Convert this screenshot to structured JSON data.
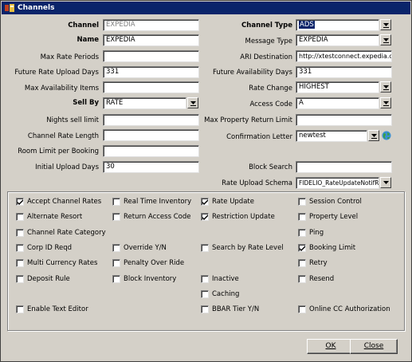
{
  "window": {
    "title": "Channels",
    "icon": "app-icon"
  },
  "form": {
    "channel": {
      "label": "Channel",
      "value": "EXPEDIA"
    },
    "name": {
      "label": "Name",
      "value": "EXPEDIA"
    },
    "max_rate_periods": {
      "label": "Max Rate Periods",
      "value": ""
    },
    "future_rate_upload_days": {
      "label": "Future Rate Upload Days",
      "value": "331"
    },
    "max_availability_items": {
      "label": "Max Availability Items",
      "value": ""
    },
    "sell_by": {
      "label": "Sell By",
      "value": "RATE"
    },
    "nights_sell_limit": {
      "label": "Nights sell limit",
      "value": ""
    },
    "channel_rate_length": {
      "label": "Channel Rate Length",
      "value": ""
    },
    "room_limit_per_booking": {
      "label": "Room Limit per Booking",
      "value": ""
    },
    "initial_upload_days": {
      "label": "Initial Upload Days",
      "value": "30"
    },
    "channel_type": {
      "label": "Channel Type",
      "value": "ADS"
    },
    "message_type": {
      "label": "Message Type",
      "value": "EXPEDIA"
    },
    "ari_destination": {
      "label": "ARI Destination",
      "value": "http://xtestconnect.expedia.co"
    },
    "future_availability_days": {
      "label": "Future Availability Days",
      "value": "331"
    },
    "rate_change": {
      "label": "Rate Change",
      "value": "HIGHEST"
    },
    "access_code": {
      "label": "Access Code",
      "value": "A"
    },
    "max_property_return_limit": {
      "label": "Max Property Return Limit",
      "value": ""
    },
    "confirmation_letter": {
      "label": "Confirmation Letter",
      "value": "newtest"
    },
    "block_search": {
      "label": "Block Search",
      "value": ""
    },
    "rate_upload_schema": {
      "label": "Rate Upload Schema",
      "value": "FIDELIO_RateUpdateNotifR..."
    }
  },
  "checkboxes": {
    "accept_channel_rates": {
      "label": "Accept Channel Rates",
      "checked": true
    },
    "real_time_inventory": {
      "label": "Real Time Inventory",
      "checked": false
    },
    "rate_update": {
      "label": "Rate Update",
      "checked": true
    },
    "session_control": {
      "label": "Session Control",
      "checked": false
    },
    "alternate_resort": {
      "label": "Alternate Resort",
      "checked": false
    },
    "return_access_code": {
      "label": "Return Access Code",
      "checked": false
    },
    "restriction_update": {
      "label": "Restriction Update",
      "checked": true
    },
    "property_level": {
      "label": "Property Level",
      "checked": false
    },
    "channel_rate_category": {
      "label": "Channel Rate Category",
      "checked": false
    },
    "ping": {
      "label": "Ping",
      "checked": false
    },
    "corp_id_reqd": {
      "label": "Corp ID Reqd",
      "checked": false
    },
    "override_yn": {
      "label": "Override Y/N",
      "checked": false
    },
    "search_by_rate_level": {
      "label": "Search by Rate Level",
      "checked": false
    },
    "booking_limit": {
      "label": "Booking Limit",
      "checked": true
    },
    "multi_currency_rates": {
      "label": "Multi Currency Rates",
      "checked": false
    },
    "penalty_over_ride": {
      "label": "Penalty Over Ride",
      "checked": false
    },
    "retry": {
      "label": "Retry",
      "checked": false
    },
    "deposit_rule": {
      "label": "Deposit Rule",
      "checked": false
    },
    "block_inventory": {
      "label": "Block Inventory",
      "checked": false
    },
    "inactive": {
      "label": "Inactive",
      "checked": false
    },
    "resend": {
      "label": "Resend",
      "checked": false
    },
    "caching": {
      "label": "Caching",
      "checked": false
    },
    "enable_text_editor": {
      "label": "Enable Text Editor",
      "checked": false
    },
    "bbar_tier_yn": {
      "label": "BBAR Tier Y/N",
      "checked": false
    },
    "online_cc_authorization": {
      "label": "Online CC Authorization",
      "checked": false
    }
  },
  "buttons": {
    "ok": "OK",
    "close": "Close"
  },
  "colors": {
    "titlebar": "#0a246a",
    "dialog": "#d4d0c8",
    "selection": "#0a246a"
  }
}
